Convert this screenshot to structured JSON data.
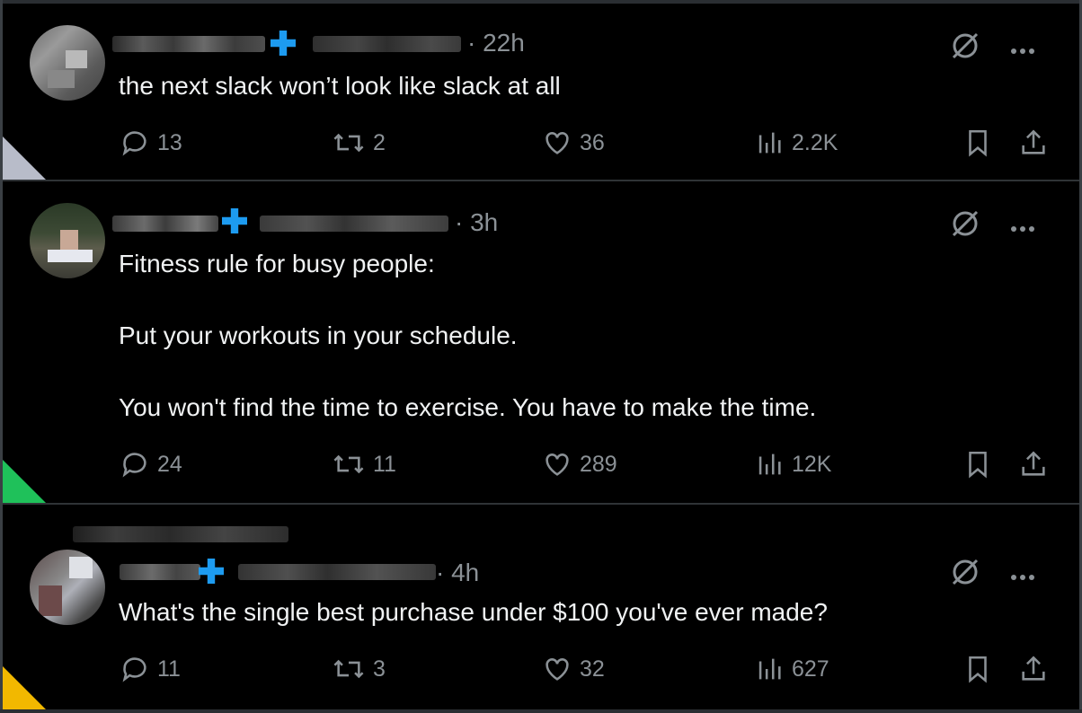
{
  "colors": {
    "background": "#000000",
    "text": "#f0f2f3",
    "muted": "#8b9196",
    "verified": "#1d9bf0",
    "divider": "#2f3336"
  },
  "tweets": [
    {
      "time": "· 22h",
      "text": "the next slack won’t look like slack at all",
      "replies": "13",
      "reposts": "2",
      "likes": "36",
      "views": "2.2K",
      "marker_color": "#b8bcc9"
    },
    {
      "time": "· 3h",
      "text": "Fitness rule for busy people:\n\nPut your workouts in your schedule.\n\nYou won't find the time to exercise. You have to make the time.",
      "replies": "24",
      "reposts": "11",
      "likes": "289",
      "views": "12K",
      "marker_color": "#1fc15a"
    },
    {
      "time": "· 4h",
      "text": "What's the single best purchase under $100 you've ever made?",
      "replies": "11",
      "reposts": "3",
      "likes": "32",
      "views": "627",
      "marker_color": "#f2b800"
    }
  ],
  "icons": {
    "reply": "reply-icon",
    "repost": "repost-icon",
    "like": "heart-icon",
    "views": "views-icon",
    "bookmark": "bookmark-icon",
    "share": "share-icon",
    "grok": "grok-icon",
    "more": "more-icon"
  }
}
